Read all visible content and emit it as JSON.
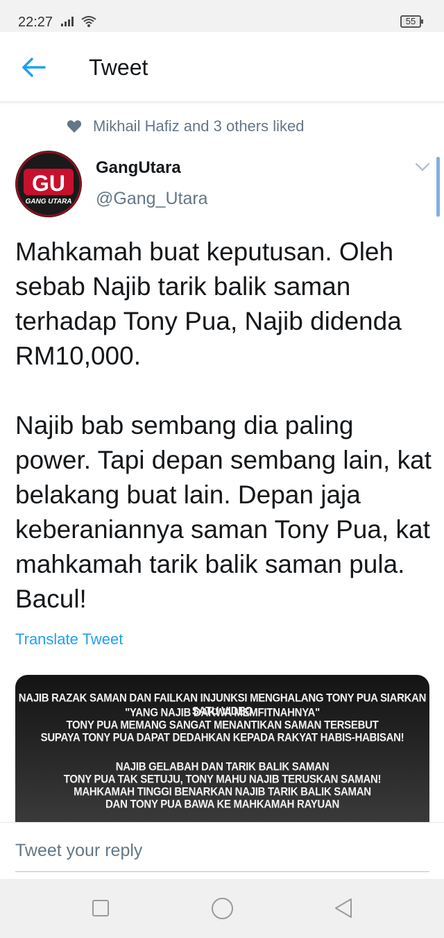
{
  "status_bar": {
    "time": "22:27",
    "battery": "55"
  },
  "header": {
    "title": "Tweet"
  },
  "social_context": {
    "text": "Mikhail Hafiz and 3 others liked"
  },
  "author": {
    "name": "GangUtara",
    "handle": "@Gang_Utara",
    "avatar_logo": "GU",
    "avatar_caption": "GANG UTARA"
  },
  "tweet": {
    "text": "Mahkamah buat keputusan. Oleh sebab Najib tarik balik saman terhadap Tony Pua, Najib didenda RM10,000.\n\nNajib bab sembang dia paling power. Tapi depan sembang lain, kat belakang buat lain. Depan jaja keberaniannya saman Tony Pua, kat mahkamah tarik balik saman pula. Bacul!",
    "translate_label": "Translate Tweet"
  },
  "media": {
    "lines": [
      "NAJIB RAZAK SAMAN DAN FAILKAN INJUNKSI MENGHALANG TONY PUA SIARKAN SATU VIDEO",
      "\"YANG NAJIB DAKWA MEMFITNAHNYA\"",
      "TONY PUA MEMANG SANGAT MENANTIKAN SAMAN TERSEBUT",
      "SUPAYA TONY PUA DAPAT DEDAHKAN KEPADA RAKYAT HABIS-HABISAN!",
      "NAJIB GELABAH DAN TARIK BALIK SAMAN",
      "TONY PUA TAK SETUJU, TONY MAHU NAJIB TERUSKAN SAMAN!",
      "MAHKAMAH TINGGI BENARKAN NAJIB TARIK BALIK SAMAN",
      "DAN TONY PUA BAWA KE MAHKAMAH RAYUAN"
    ]
  },
  "reply": {
    "placeholder": "Tweet your reply"
  },
  "colors": {
    "accent": "#1da1f2",
    "secondary_text": "#657786",
    "primary_text": "#14171a",
    "logo_red": "#c8102e"
  },
  "icons": [
    "signal-icon",
    "wifi-icon",
    "battery-icon",
    "back-arrow-icon",
    "heart-icon",
    "chevron-down-icon",
    "nav-recent-icon",
    "nav-home-icon",
    "nav-back-icon"
  ]
}
